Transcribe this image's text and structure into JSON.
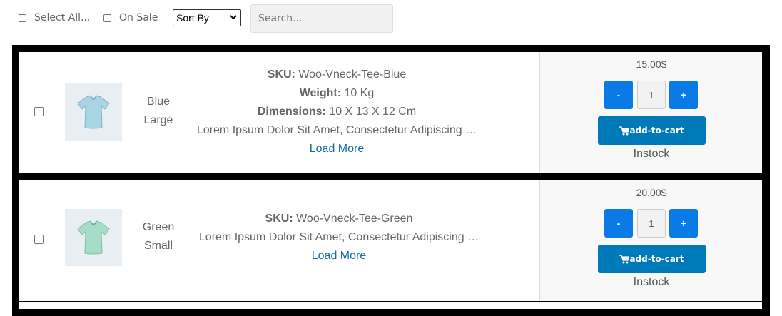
{
  "toolbar": {
    "select_all_label": "Select All...",
    "on_sale_label": "On Sale",
    "sort_value": "Sort By",
    "search_placeholder": "Search..."
  },
  "products": [
    {
      "variant_line1": "Blue",
      "variant_line2": "Large",
      "sku_label": "SKU:",
      "sku": "Woo-Vneck-Tee-Blue",
      "weight_label": "Weight:",
      "weight": "10 Kg",
      "dimensions_label": "Dimensions:",
      "dimensions": "10 X 13 X 12 Cm",
      "description": "Lorem Ipsum Dolor Sit Amet, Consectetur Adipiscing …",
      "load_more": "Load More",
      "price": "15.00$",
      "qty_minus": "-",
      "qty": "1",
      "qty_plus": "+",
      "cart_label": "add-to-cart",
      "stock": "Instock",
      "shirt_color": "#a9d4e3"
    },
    {
      "variant_line1": "Green",
      "variant_line2": "Small",
      "sku_label": "SKU:",
      "sku": "Woo-Vneck-Tee-Green",
      "description": "Lorem Ipsum Dolor Sit Amet, Consectetur Adipiscing …",
      "load_more": "Load More",
      "price": "20.00$",
      "qty_minus": "-",
      "qty": "1",
      "qty_plus": "+",
      "cart_label": "add-to-cart",
      "stock": "Instock",
      "shirt_color": "#a7ddc8"
    }
  ],
  "colors": {
    "button_blue": "#0a7ae6",
    "cart_blue": "#0079b8",
    "link": "#0f6aa0"
  }
}
